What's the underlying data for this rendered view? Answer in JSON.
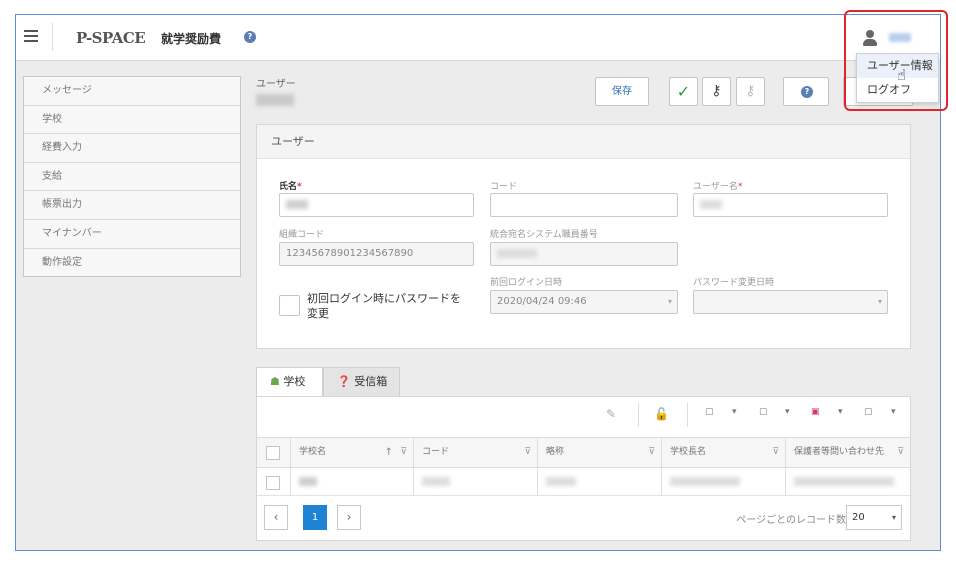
{
  "header": {
    "logo": "P-SPACE",
    "app_title": "就学奨励費",
    "help_icon": "?"
  },
  "sidebar": {
    "items": [
      "メッセージ",
      "学校",
      "経費入力",
      "支給",
      "帳票出力",
      "マイナンバー",
      "動作設定"
    ]
  },
  "page": {
    "label": "ユーザー"
  },
  "toolbar": {
    "save_label": "保存",
    "check_icon": "✓",
    "key_icon": "⚷",
    "key_reset_icon": "⚷"
  },
  "user_card": {
    "title": "ユーザー",
    "fields": {
      "name_label": "氏名",
      "code_label": "コード",
      "username_label": "ユーザー名",
      "org_code_label": "組織コード",
      "org_code_value": "12345678901234567890",
      "staff_no_label": "統合宛名システム職員番号",
      "last_login_label": "前回ログイン日時",
      "last_login_value": "2020/04/24 09:46",
      "pw_change_label": "パスワード変更日時",
      "required_mark": "*"
    },
    "checkbox_label": "初回ログイン時にパスワードを変更"
  },
  "tabs": [
    {
      "label": "学校",
      "icon": "school-icon"
    },
    {
      "label": "受信箱",
      "icon": "question-icon"
    }
  ],
  "grid": {
    "columns": [
      "学校名",
      "コード",
      "略称",
      "学校長名",
      "保護者等問い合わせ先"
    ],
    "sort_glyph": "↑",
    "filter_glyph": "⊽"
  },
  "pager": {
    "prev": "‹",
    "current": "1",
    "next": "›",
    "records_label": "ページごとのレコード数",
    "records_value": "20"
  },
  "user_menu": {
    "items": [
      "ユーザー情報",
      "ログオフ"
    ]
  },
  "colors": {
    "accent": "#1f83d4",
    "highlight": "#e0262d",
    "required": "#d9363e"
  }
}
